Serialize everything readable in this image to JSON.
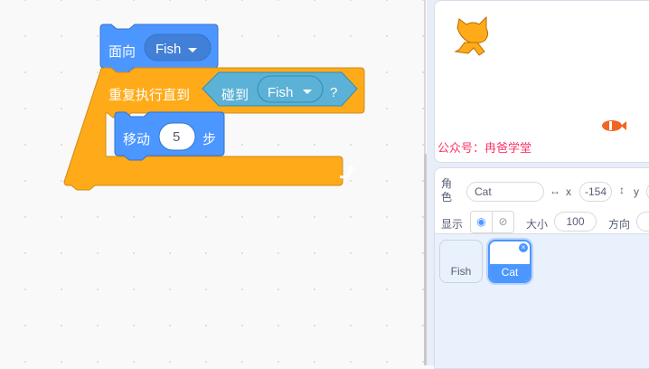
{
  "blocks": {
    "point_towards": {
      "label": "面向",
      "target": "Fish"
    },
    "repeat_until": {
      "label": "重复执行直到"
    },
    "touching": {
      "label": "碰到",
      "target": "Fish",
      "suffix": "?"
    },
    "move": {
      "label": "移动",
      "steps": "5",
      "unit": "步"
    }
  },
  "stage": {
    "watermark": "公众号：冉爸学堂"
  },
  "sprite_info": {
    "sprite_label": "角色",
    "name": "Cat",
    "x_label": "x",
    "x": "-154",
    "y_label": "y",
    "show_label": "显示",
    "size_label": "大小",
    "size": "100",
    "direction_label": "方向"
  },
  "sprites": [
    {
      "name": "Fish",
      "selected": false
    },
    {
      "name": "Cat",
      "selected": true
    }
  ],
  "colors": {
    "motion": "#4c97ff",
    "control": "#ffab19",
    "sensing": "#5cb1d6"
  }
}
